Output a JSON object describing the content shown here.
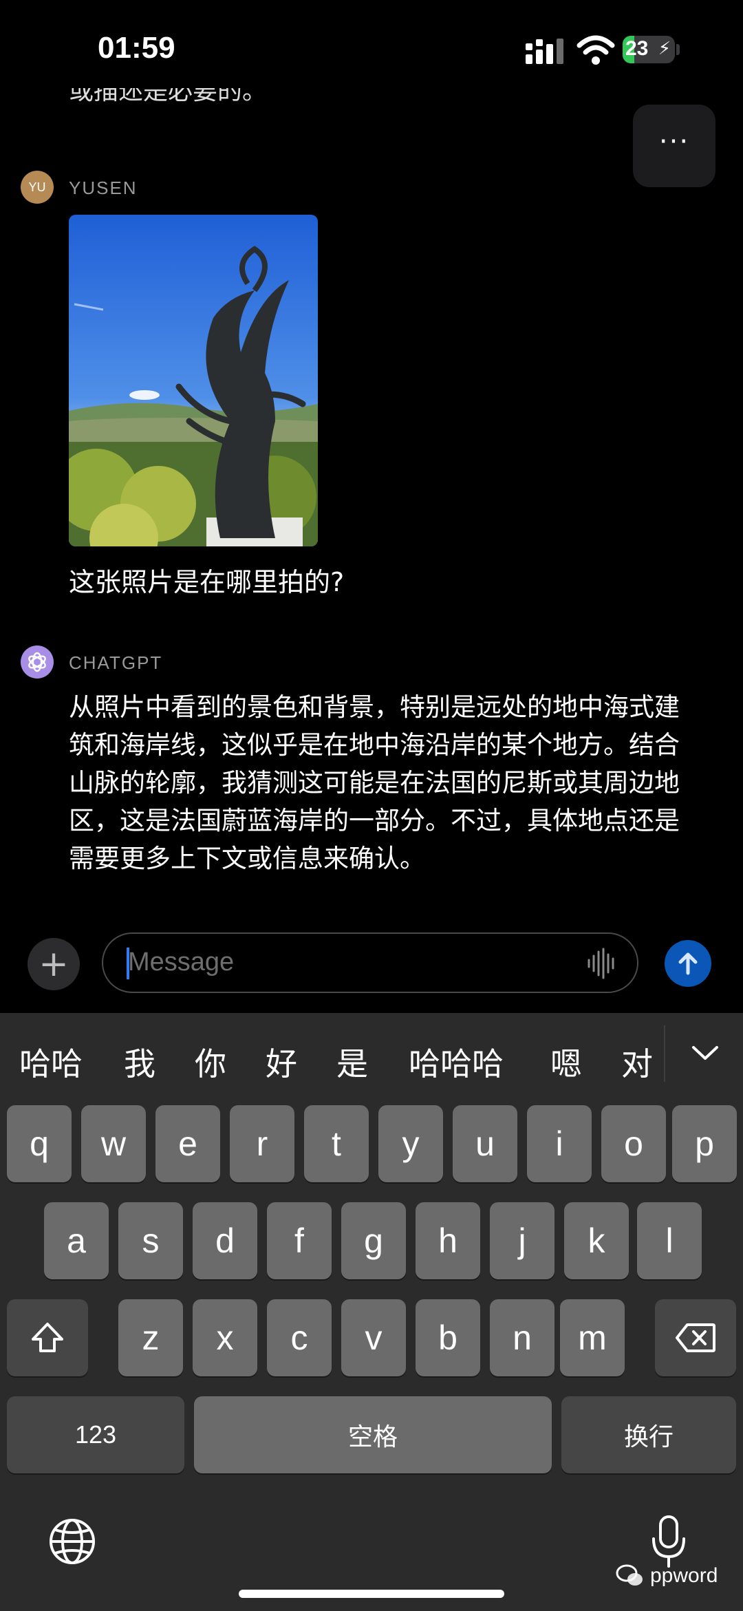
{
  "status_bar": {
    "time": "01:59",
    "battery": "23",
    "battery_level": 0.23
  },
  "chat": {
    "cut_off_line": "或描述是必要的。",
    "more_label": "···",
    "user": {
      "avatar": "YU",
      "name": "YUSEN",
      "message": "这张照片是在哪里拍的?"
    },
    "assistant": {
      "name": "CHATGPT",
      "message": "从照片中看到的景色和背景，特别是远处的地中海式建筑和海岸线，这似乎是在地中海沿岸的某个地方。结合山脉的轮廓，我猜测这可能是在法国的尼斯或其周边地区，这是法国蔚蓝海岸的一部分。不过，具体地点还是需要更多上下文或信息来确认。"
    }
  },
  "composer": {
    "plus": "+",
    "placeholder": "Message"
  },
  "keyboard": {
    "candidates": [
      "哈哈",
      "我",
      "你",
      "好",
      "是",
      "哈哈哈",
      "嗯",
      "对"
    ],
    "row1": [
      "q",
      "w",
      "e",
      "r",
      "t",
      "y",
      "u",
      "i",
      "o",
      "p"
    ],
    "row2": [
      "a",
      "s",
      "d",
      "f",
      "g",
      "h",
      "j",
      "k",
      "l"
    ],
    "row3": [
      "z",
      "x",
      "c",
      "v",
      "b",
      "n",
      "m"
    ],
    "numbers_key": "123",
    "space_key": "空格",
    "return_key": "换行"
  },
  "watermark": "ppword",
  "icons": [
    "cellular-icon",
    "wifi-icon",
    "battery-icon",
    "more-icon",
    "chatgpt-logo-icon",
    "waveform-icon",
    "send-arrow-icon",
    "shift-icon",
    "backspace-icon",
    "globe-icon",
    "mic-icon",
    "chevron-down-icon",
    "wechat-icon"
  ]
}
